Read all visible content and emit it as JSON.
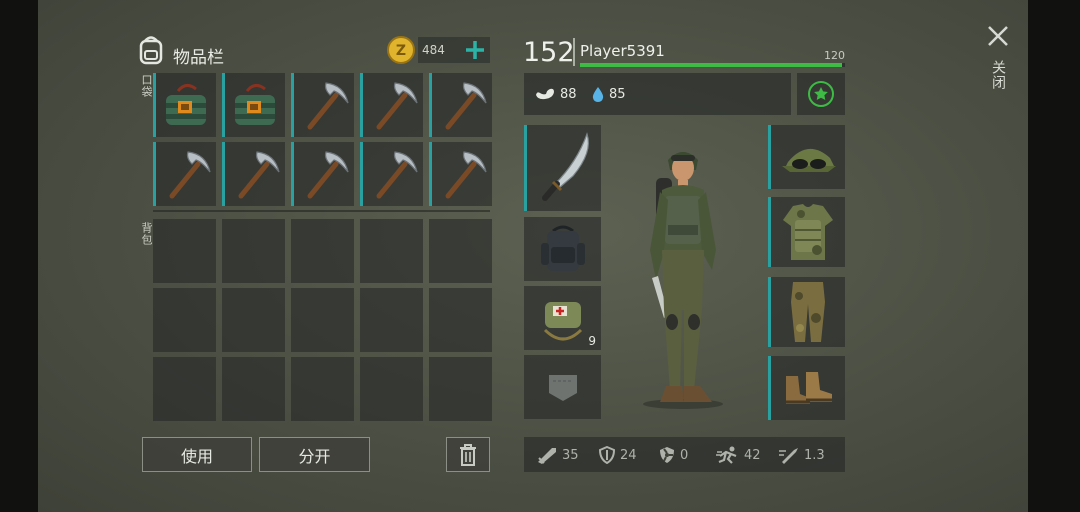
{
  "inventory": {
    "title": "物品栏",
    "coins": "484",
    "section_pockets": "口袋",
    "section_backpack": "背包",
    "pocket_items": [
      {
        "icon": "explosive-bundle-icon"
      },
      {
        "icon": "explosive-bundle-icon"
      },
      {
        "icon": "pickaxe-icon"
      },
      {
        "icon": "pickaxe-icon"
      },
      {
        "icon": "pickaxe-icon"
      },
      {
        "icon": "pickaxe-icon"
      },
      {
        "icon": "pickaxe-icon"
      },
      {
        "icon": "pickaxe-icon"
      },
      {
        "icon": "pickaxe-icon"
      },
      {
        "icon": "pickaxe-icon"
      }
    ],
    "use_label": "使用",
    "split_label": "分开"
  },
  "player": {
    "level": "152",
    "name": "Player5391",
    "xp_max": "120",
    "xp_fill": 0.99,
    "hunger": "88",
    "thirst": "85"
  },
  "equipment": {
    "left": [
      {
        "icon": "machete-icon",
        "count": ""
      },
      {
        "icon": "backpack-icon",
        "count": ""
      },
      {
        "icon": "medkit-bag-icon",
        "count": "9"
      },
      {
        "icon": "pocket-icon",
        "count": ""
      }
    ],
    "right": [
      {
        "icon": "cap-goggles-icon"
      },
      {
        "icon": "camo-vest-icon"
      },
      {
        "icon": "camo-pants-icon"
      },
      {
        "icon": "boots-icon"
      }
    ]
  },
  "stats": {
    "attack": "35",
    "defense": "24",
    "radiation": "0",
    "speed": "42",
    "attack_speed": "1.3"
  },
  "close_label": "关闭",
  "colors": {
    "accent": "#2aa1a1",
    "xp_bar": "#3dbb45",
    "coin": "#e0b42c",
    "plus": "#2bb3a8"
  }
}
